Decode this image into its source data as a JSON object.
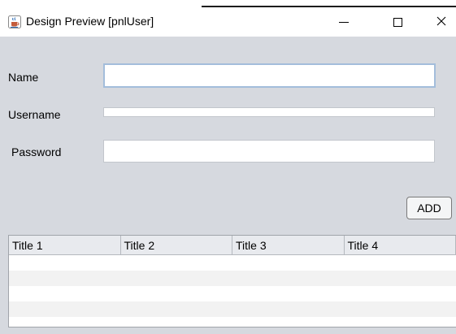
{
  "window": {
    "title": "Design Preview [pnlUser]"
  },
  "titlebar_buttons": {
    "minimize_icon": "minimize-icon",
    "maximize_icon": "maximize-icon",
    "close_icon": "close-icon",
    "close_glyph": "✕"
  },
  "form": {
    "name_label": "Name",
    "name_value": "",
    "username_label": "Username",
    "username_value": "",
    "password_label": "Password",
    "password_value": ""
  },
  "add_button": {
    "label": "ADD"
  },
  "table": {
    "columns": [
      "Title 1",
      "Title 2",
      "Title 3",
      "Title 4"
    ],
    "rows": [
      [
        "",
        "",
        "",
        ""
      ],
      [
        "",
        "",
        "",
        ""
      ],
      [
        "",
        "",
        "",
        ""
      ],
      [
        "",
        "",
        "",
        ""
      ]
    ]
  },
  "colors": {
    "panel_background": "#d6d9df",
    "focus_border": "#a3bddb"
  }
}
